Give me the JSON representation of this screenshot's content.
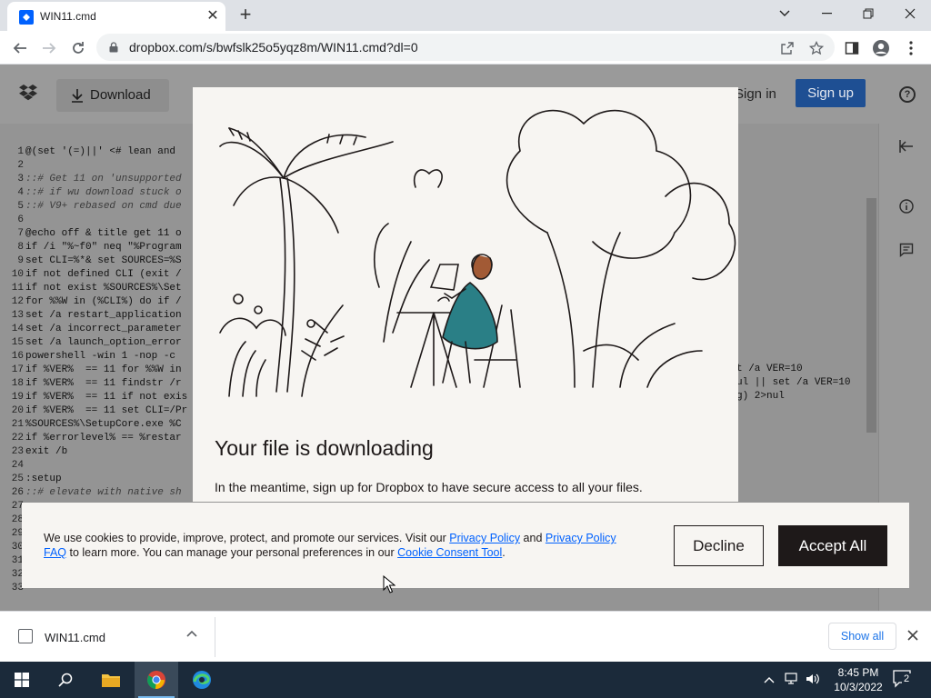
{
  "browser": {
    "tab_title": "WIN11.cmd",
    "url": "dropbox.com/s/bwfslk25o5yqz8m/WIN11.cmd?dl=0"
  },
  "dropbox": {
    "download_label": "Download",
    "signin_label": "Sign in",
    "signup_label": "Sign up",
    "help_label": "?"
  },
  "code": {
    "lines": [
      {
        "n": "1",
        "t": "@(set '(=)||' <# lean and"
      },
      {
        "n": "2",
        "t": ""
      },
      {
        "n": "3",
        "t": "::# Get 11 on 'unsupported"
      },
      {
        "n": "4",
        "t": "::# if wu download stuck o"
      },
      {
        "n": "5",
        "t": "::# V9+ rebased on cmd due"
      },
      {
        "n": "6",
        "t": ""
      },
      {
        "n": "7",
        "t": "@echo off & title get 11 o"
      },
      {
        "n": "8",
        "t": "if /i \"%~f0\" neq \"%Program"
      },
      {
        "n": "9",
        "t": "set CLI=%*& set SOURCES=%S"
      },
      {
        "n": "10",
        "t": "if not defined CLI (exit /"
      },
      {
        "n": "11",
        "t": "if not exist %SOURCES%\\Set"
      },
      {
        "n": "12",
        "t": "for %%W in (%CLI%) do if /"
      },
      {
        "n": "13",
        "t": "set /a restart_application"
      },
      {
        "n": "14",
        "t": "set /a incorrect_parameter"
      },
      {
        "n": "15",
        "t": "set /a launch_option_error"
      },
      {
        "n": "16",
        "t": "powershell -win 1 -nop -c"
      },
      {
        "n": "17",
        "t": "if %VER%  == 11 for %%W in"
      },
      {
        "n": "18",
        "t": "if %VER%  == 11 findstr /r"
      },
      {
        "n": "19",
        "t": "if %VER%  == 11 if not exis"
      },
      {
        "n": "20",
        "t": "if %VER%  == 11 set CLI=/Pr"
      },
      {
        "n": "21",
        "t": "%SOURCES%\\SetupCore.exe %C"
      },
      {
        "n": "22",
        "t": "if %errorlevel% == %restar"
      },
      {
        "n": "23",
        "t": "exit /b"
      },
      {
        "n": "24",
        "t": ""
      },
      {
        "n": "25",
        "t": ":setup"
      },
      {
        "n": "26",
        "t": "::# elevate with native sh"
      },
      {
        "n": "27",
        "t": ""
      },
      {
        "n": "28",
        "t": ""
      },
      {
        "n": "29",
        "t": ""
      },
      {
        "n": "30",
        "t": ""
      },
      {
        "n": "31",
        "t": ""
      },
      {
        "n": "32",
        "t": ""
      },
      {
        "n": "33",
        "t": ""
      }
    ],
    "right_lines": [
      "t /a VER=10",
      "ul || set /a VER=10",
      "g) 2>nul"
    ]
  },
  "modal": {
    "title": "Your file is downloading",
    "text": "In the meantime, sign up for Dropbox to have secure access to all your files. Collaborate with friends, family, and coworkers from any device."
  },
  "cookie": {
    "text_1": "We use cookies to provide, improve, protect, and promote our services. Visit our ",
    "link_privacy": "Privacy Policy",
    "text_and": " and ",
    "link_privacy_faq": "Privacy Policy FAQ",
    "text_2": " to learn more. You can manage your personal preferences in our ",
    "link_consent": "Cookie Consent Tool",
    "text_end": ".",
    "decline_label": "Decline",
    "accept_label": "Accept All"
  },
  "downloads": {
    "file_name": "WIN11.cmd",
    "show_all_label": "Show all"
  },
  "taskbar": {
    "time": "8:45 PM",
    "date": "10/3/2022",
    "notifications": "2"
  },
  "colors": {
    "accent_blue": "#0061fe",
    "signup_blue": "#1e4f93",
    "taskbar": "#1b2a3a"
  }
}
